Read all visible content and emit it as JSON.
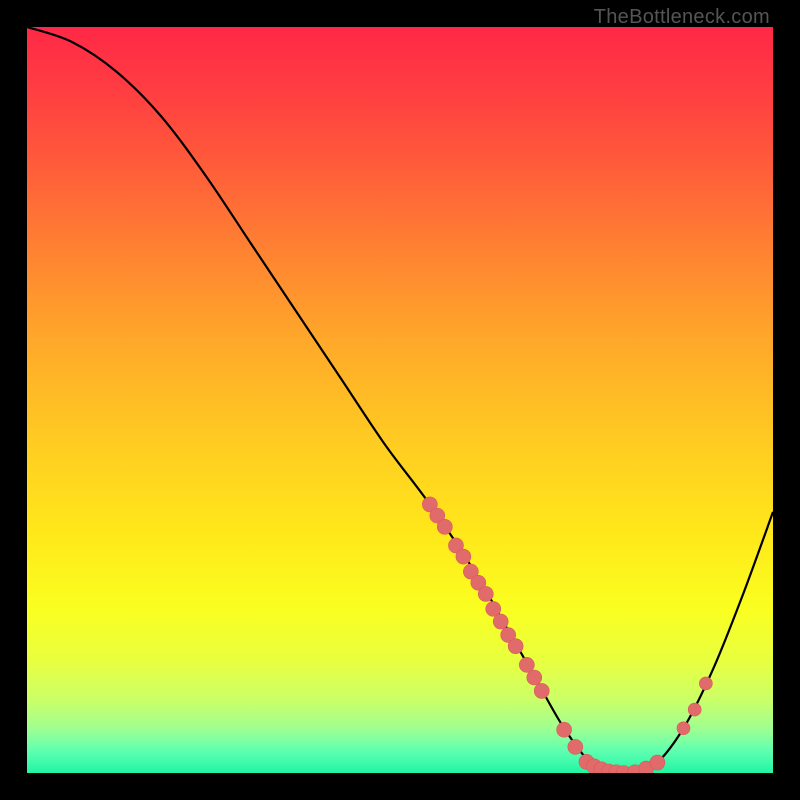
{
  "watermark": "TheBottleneck.com",
  "chart_data": {
    "type": "line",
    "title": "",
    "xlabel": "",
    "ylabel": "",
    "xlim": [
      0,
      100
    ],
    "ylim": [
      0,
      100
    ],
    "series": [
      {
        "name": "bottleneck-curve",
        "x": [
          0,
          6,
          12,
          18,
          24,
          30,
          36,
          42,
          48,
          54,
          60,
          64,
          68,
          72,
          76,
          80,
          84,
          88,
          92,
          96,
          100
        ],
        "y": [
          100,
          98,
          94,
          88,
          80,
          71,
          62,
          53,
          44,
          36,
          27,
          20,
          13,
          6,
          1,
          0,
          1,
          6,
          14,
          24,
          35
        ]
      }
    ],
    "markers": {
      "descending_cluster": [
        {
          "x": 54.0,
          "y": 36.0
        },
        {
          "x": 55.0,
          "y": 34.5
        },
        {
          "x": 56.0,
          "y": 33.0
        },
        {
          "x": 57.5,
          "y": 30.5
        },
        {
          "x": 58.5,
          "y": 29.0
        },
        {
          "x": 59.5,
          "y": 27.0
        },
        {
          "x": 60.5,
          "y": 25.5
        },
        {
          "x": 61.5,
          "y": 24.0
        },
        {
          "x": 62.5,
          "y": 22.0
        },
        {
          "x": 63.5,
          "y": 20.3
        },
        {
          "x": 64.5,
          "y": 18.5
        },
        {
          "x": 65.5,
          "y": 17.0
        },
        {
          "x": 67.0,
          "y": 14.5
        },
        {
          "x": 68.0,
          "y": 12.8
        },
        {
          "x": 69.0,
          "y": 11.0
        }
      ],
      "valley_cluster": [
        {
          "x": 72.0,
          "y": 5.8
        },
        {
          "x": 73.5,
          "y": 3.5
        },
        {
          "x": 75.0,
          "y": 1.5
        },
        {
          "x": 76.0,
          "y": 0.9
        },
        {
          "x": 77.0,
          "y": 0.5
        },
        {
          "x": 78.0,
          "y": 0.2
        },
        {
          "x": 79.0,
          "y": 0.1
        },
        {
          "x": 80.0,
          "y": 0.0
        },
        {
          "x": 81.5,
          "y": 0.1
        },
        {
          "x": 83.0,
          "y": 0.6
        },
        {
          "x": 84.5,
          "y": 1.4
        }
      ],
      "ascending_pair": [
        {
          "x": 88.0,
          "y": 6.0
        },
        {
          "x": 89.5,
          "y": 8.5
        },
        {
          "x": 91.0,
          "y": 12.0
        }
      ]
    },
    "colors": {
      "curve": "#000000",
      "marker_fill": "#e16a6a",
      "marker_stroke": "#d85a5a"
    }
  }
}
